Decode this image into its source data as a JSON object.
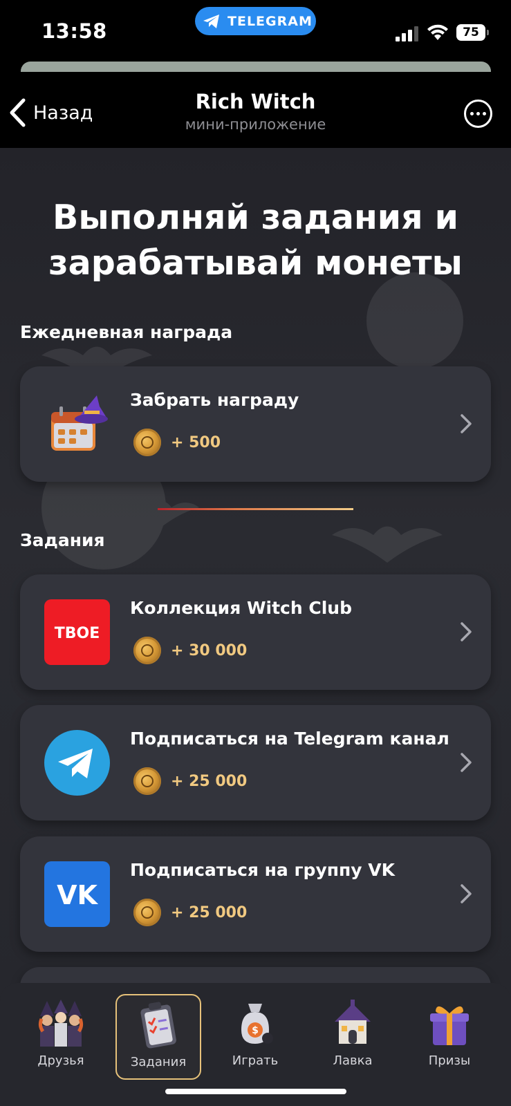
{
  "status_bar": {
    "time": "13:58",
    "pill_label": "TELEGRAM",
    "battery": "75"
  },
  "header": {
    "back_label": "Назад",
    "title": "Rich Witch",
    "subtitle": "мини-приложение"
  },
  "page_title": "Выполняй задания и зарабатывай монеты",
  "daily": {
    "section_title": "Ежедневная награда",
    "card": {
      "title": "Забрать награду",
      "reward": "+ 500",
      "icon": "calendar-witch-hat-icon"
    }
  },
  "tasks": {
    "section_title": "Задания",
    "items": [
      {
        "title": "Коллекция Witch Club",
        "reward": "+ 30 000",
        "icon": "tvoe-logo",
        "logo_text": "ТВОЕ",
        "color": "#ee1c25"
      },
      {
        "title": "Подписаться на Telegram канал",
        "reward": "+ 25 000",
        "icon": "telegram-icon",
        "color": "#2aa2e0"
      },
      {
        "title": "Подписаться на группу VK",
        "reward": "+ 25 000",
        "icon": "vk-icon",
        "logo_text": "VK",
        "color": "#2375e0"
      }
    ]
  },
  "nav": {
    "items": [
      {
        "label": "Друзья",
        "icon": "friends-icon"
      },
      {
        "label": "Задания",
        "icon": "tasks-icon",
        "active": true
      },
      {
        "label": "Играть",
        "icon": "money-bag-icon"
      },
      {
        "label": "Лавка",
        "icon": "shop-house-icon"
      },
      {
        "label": "Призы",
        "icon": "gift-icon"
      }
    ]
  },
  "colors": {
    "accent_gold": "#f1c981",
    "card_bg": "#33343c",
    "page_bg": "#26272d"
  }
}
